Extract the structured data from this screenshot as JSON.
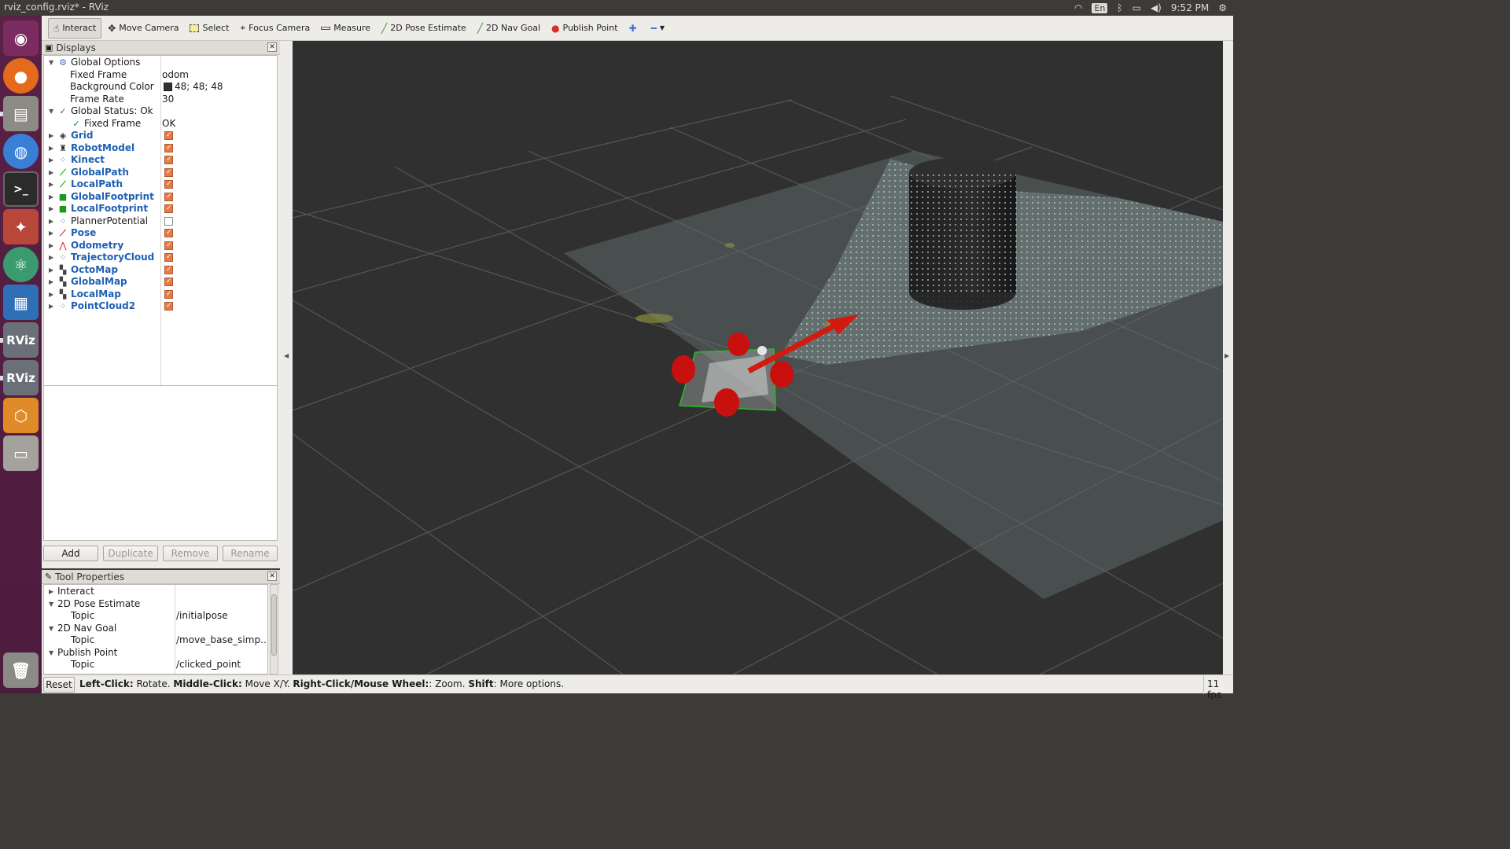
{
  "window": {
    "title": "rviz_config.rviz* - RViz"
  },
  "system_tray": {
    "language": "En",
    "time": "9:52 PM"
  },
  "toolbar": {
    "tools": [
      {
        "label": "Interact",
        "icon": "hand-icon",
        "active": true
      },
      {
        "label": "Move Camera",
        "icon": "move-camera-icon",
        "active": false
      },
      {
        "label": "Select",
        "icon": "select-icon",
        "active": false
      },
      {
        "label": "Focus Camera",
        "icon": "focus-camera-icon",
        "active": false
      },
      {
        "label": "Measure",
        "icon": "measure-icon",
        "active": false
      },
      {
        "label": "2D Pose Estimate",
        "icon": "pose-estimate-arrow-icon",
        "active": false
      },
      {
        "label": "2D Nav Goal",
        "icon": "nav-goal-arrow-icon",
        "active": false
      },
      {
        "label": "Publish Point",
        "icon": "map-pin-icon",
        "active": false
      }
    ]
  },
  "displays_panel": {
    "title": "Displays",
    "global_options": {
      "label": "Global Options",
      "fixed_frame": {
        "label": "Fixed Frame",
        "value": "odom"
      },
      "background_color": {
        "label": "Background Color",
        "value": "48; 48; 48",
        "swatch": "#303030"
      },
      "frame_rate": {
        "label": "Frame Rate",
        "value": "30"
      }
    },
    "global_status": {
      "label": "Global Status: Ok",
      "fixed_frame": {
        "label": "Fixed Frame",
        "value": "OK"
      }
    },
    "displays": [
      {
        "label": "Grid",
        "icon": "grid-icon",
        "enabled": true
      },
      {
        "label": "RobotModel",
        "icon": "robot-model-icon",
        "enabled": true
      },
      {
        "label": "Kinect",
        "icon": "point-cloud-icon",
        "enabled": true
      },
      {
        "label": "GlobalPath",
        "icon": "path-icon",
        "enabled": true
      },
      {
        "label": "LocalPath",
        "icon": "path-icon",
        "enabled": true
      },
      {
        "label": "GlobalFootprint",
        "icon": "polygon-icon",
        "enabled": true
      },
      {
        "label": "LocalFootprint",
        "icon": "polygon-icon",
        "enabled": true
      },
      {
        "label": "PlannerPotential",
        "icon": "point-cloud-icon",
        "enabled": false
      },
      {
        "label": "Pose",
        "icon": "pose-arrow-icon",
        "enabled": true
      },
      {
        "label": "Odometry",
        "icon": "odometry-icon",
        "enabled": true
      },
      {
        "label": "TrajectoryCloud",
        "icon": "point-cloud-icon",
        "enabled": true
      },
      {
        "label": "OctoMap",
        "icon": "map-icon",
        "enabled": true
      },
      {
        "label": "GlobalMap",
        "icon": "map-icon",
        "enabled": true
      },
      {
        "label": "LocalMap",
        "icon": "map-icon",
        "enabled": true
      },
      {
        "label": "PointCloud2",
        "icon": "point-cloud-icon",
        "enabled": true
      }
    ],
    "buttons": {
      "add": "Add",
      "duplicate": "Duplicate",
      "remove": "Remove",
      "rename": "Rename"
    }
  },
  "tool_properties": {
    "title": "Tool Properties",
    "items": [
      {
        "label": "Interact"
      },
      {
        "label": "2D Pose Estimate",
        "topic_label": "Topic",
        "topic": "/initialpose"
      },
      {
        "label": "2D Nav Goal",
        "topic_label": "Topic",
        "topic": "/move_base_simp…"
      },
      {
        "label": "Publish Point",
        "topic_label": "Topic",
        "topic": "/clicked_point"
      }
    ]
  },
  "status_bar": {
    "reset": "Reset",
    "hint": [
      {
        "key": "Left-Click:",
        "text": " Rotate. "
      },
      {
        "key": "Middle-Click:",
        "text": " Move X/Y. "
      },
      {
        "key": "Right-Click/Mouse Wheel:",
        "text": ": Zoom. "
      },
      {
        "key": "Shift",
        "text": ": More options."
      }
    ],
    "fps": "11 fps"
  },
  "colors": {
    "viewport_background": "#303030",
    "robot_wheels": "#c8100e",
    "pose_arrow": "#d11a10",
    "footprint": "#22c022",
    "display_name": "#1e5fb4",
    "checkbox_on": "#e87844"
  }
}
